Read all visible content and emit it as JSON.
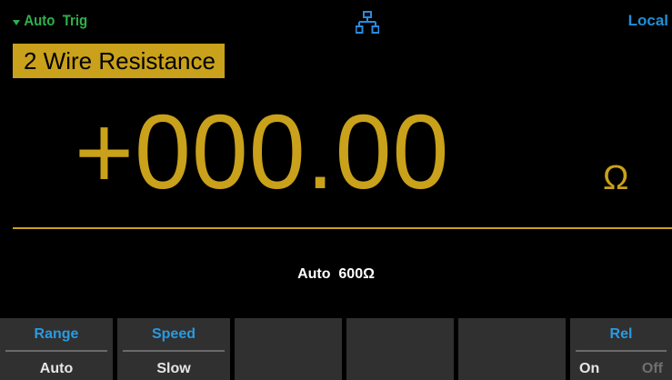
{
  "status": {
    "trigger_mode": "Auto  Trig",
    "lan_icon": "lan-network-icon",
    "remote_state": "Local"
  },
  "measurement": {
    "function_title": "2 Wire Resistance",
    "reading": "+000.00",
    "unit": "Ω",
    "range_info": "Auto  600Ω"
  },
  "softkeys": [
    {
      "label": "Range",
      "value": "Auto"
    },
    {
      "label": "Speed",
      "value": "Slow"
    },
    {
      "label": "",
      "value": ""
    },
    {
      "label": "",
      "value": ""
    },
    {
      "label": "",
      "value": ""
    },
    {
      "label": "Rel",
      "on": "On",
      "off": "Off",
      "selected": "On"
    }
  ],
  "colors": {
    "accent_yellow": "#c9a11a",
    "status_green": "#2fb04a",
    "label_blue": "#2a9ae0",
    "background": "#000000",
    "softkey_bg": "#303030"
  }
}
